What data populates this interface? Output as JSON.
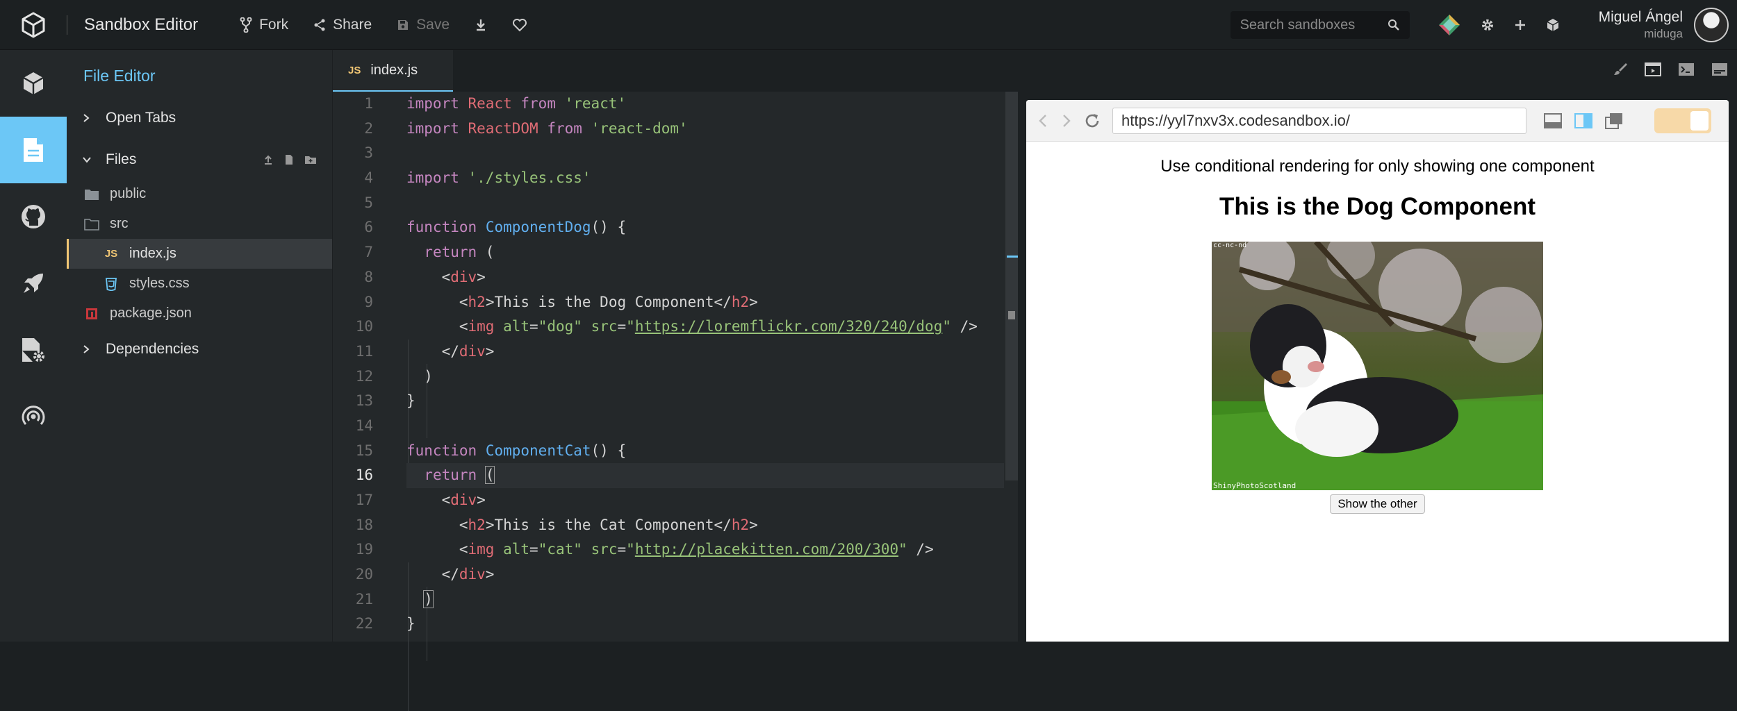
{
  "header": {
    "title": "Sandbox Editor",
    "fork_label": "Fork",
    "share_label": "Share",
    "save_label": "Save",
    "search_placeholder": "Search sandboxes",
    "user_name": "Miguel Ángel",
    "user_handle": "miduga"
  },
  "sidebar": {
    "title": "File Editor",
    "open_tabs": "Open Tabs",
    "files": "Files",
    "items": [
      {
        "name": "public",
        "type": "folder"
      },
      {
        "name": "src",
        "type": "folder-open"
      },
      {
        "name": "index.js",
        "type": "js"
      },
      {
        "name": "styles.css",
        "type": "css"
      },
      {
        "name": "package.json",
        "type": "npm"
      }
    ],
    "dependencies": "Dependencies"
  },
  "tab": {
    "badge": "JS",
    "label": "index.js"
  },
  "editor": {
    "current_line": 16,
    "line_numbers": [
      "1",
      "2",
      "3",
      "4",
      "5",
      "6",
      "7",
      "8",
      "9",
      "10",
      "11",
      "12",
      "13",
      "14",
      "15",
      "16",
      "17",
      "18",
      "19",
      "20",
      "21",
      "22"
    ]
  },
  "preview": {
    "url": "https://yyl7nxv3x.codesandbox.io/",
    "heading": "Use conditional rendering for only showing one component",
    "subheading": "This is the Dog Component",
    "image_caption_top": "cc-nc-nd",
    "image_caption_bottom": "ShinyPhotoScotland",
    "button_label": "Show the other"
  },
  "colors": {
    "accent": "#6cc7f6",
    "js_badge": "#f0c674",
    "toggle": "#f7d9a8"
  }
}
